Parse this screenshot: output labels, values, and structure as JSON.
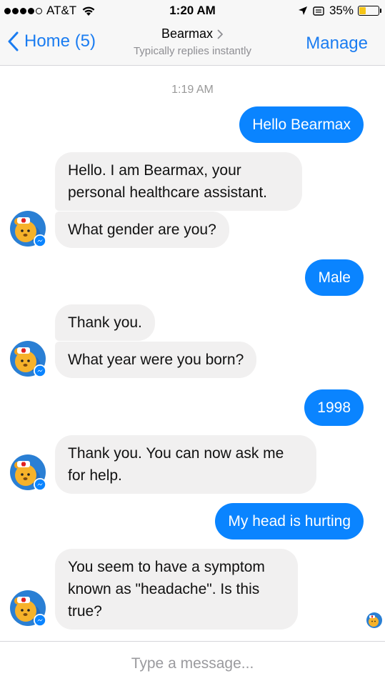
{
  "status_bar": {
    "carrier": "AT&T",
    "time": "1:20 AM",
    "battery_percent": "35%",
    "battery_level": 0.35,
    "signal_bars_filled": 4,
    "signal_bars_total": 5
  },
  "nav": {
    "back_label": "Home (5)",
    "title": "Bearmax",
    "subtitle": "Typically replies instantly",
    "manage_label": "Manage"
  },
  "chat": {
    "timestamp": "1:19 AM",
    "messages": [
      {
        "from": "user",
        "text": "Hello Bearmax"
      },
      {
        "from": "bot",
        "text": "Hello. I am Bearmax, your personal healthcare assistant."
      },
      {
        "from": "bot",
        "text": "What gender are you?"
      },
      {
        "from": "user",
        "text": "Male"
      },
      {
        "from": "bot",
        "text": "Thank you."
      },
      {
        "from": "bot",
        "text": "What year were you born?"
      },
      {
        "from": "user",
        "text": "1998"
      },
      {
        "from": "bot",
        "text": "Thank you. You can now ask me for help."
      },
      {
        "from": "user",
        "text": "My head is hurting"
      },
      {
        "from": "bot",
        "text": "You seem to have a symptom known as \"headache\". Is this true?"
      }
    ]
  },
  "composer": {
    "placeholder": "Type a message..."
  },
  "colors": {
    "accent": "#1a7cf1",
    "outgoing_bubble": "#0a84ff",
    "incoming_bubble": "#f1f0f0",
    "battery_fill": "#f5c518"
  },
  "icons": {
    "back": "chevron-left-icon",
    "title_chevron": "chevron-right-icon",
    "avatar": "bearmax-bot-avatar",
    "messenger_badge": "messenger-badge-icon"
  }
}
